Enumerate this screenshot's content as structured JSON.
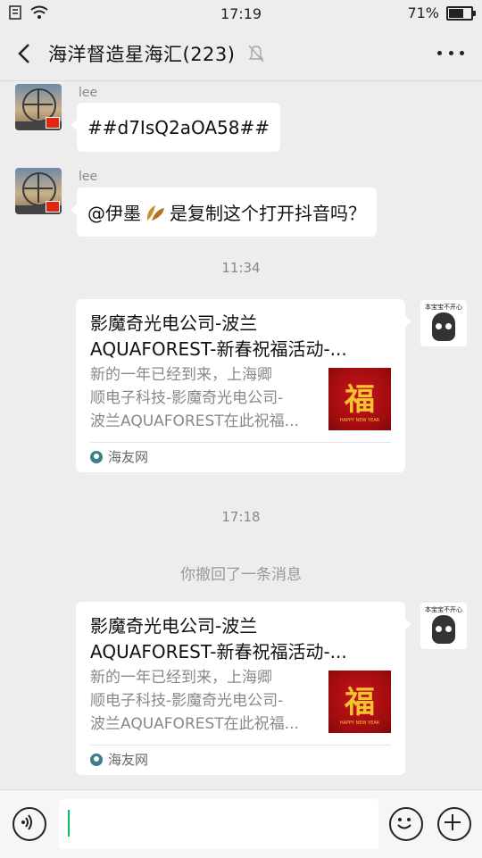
{
  "status_bar": {
    "time": "17:19",
    "battery": "71%",
    "battery_level": 0.71
  },
  "header": {
    "title": "海洋督造星海汇(223)"
  },
  "messages": {
    "m1": {
      "sender": "lee",
      "text": "##d7IsQ2aOA58##"
    },
    "m2": {
      "sender": "lee",
      "text_before": "@伊墨",
      "text_after": " 是复制这个打开抖音吗？"
    },
    "time1": "11:34",
    "card1": {
      "title_line1": "影魔奇光电公司-波兰",
      "title_line2": "AQUAFOREST-新春祝福活动-...",
      "desc_line1": "新的一年已经到来，上海卿",
      "desc_line2": "顺电子科技-影魔奇光电公司-",
      "desc_line3": "波兰AQUAFOREST在此祝福...",
      "thumb_text": "福",
      "source": "海友网"
    },
    "time2": "17:18",
    "recall": "你撤回了一条消息",
    "card2": {
      "title_line1": "影魔奇光电公司-波兰",
      "title_line2": "AQUAFOREST-新春祝福活动-...",
      "desc_line1": "新的一年已经到来，上海卿",
      "desc_line2": "顺电子科技-影魔奇光电公司-",
      "desc_line3": "波兰AQUAFOREST在此祝福...",
      "thumb_text": "福",
      "source": "海友网"
    },
    "my_avatar_caption": "本宝宝不开心"
  },
  "icons": {
    "back": "back-arrow-icon",
    "mute": "bell-muted-icon",
    "more": "more-dots-icon",
    "voice": "voice-icon",
    "emoji": "emoji-icon",
    "plus": "plus-icon"
  }
}
